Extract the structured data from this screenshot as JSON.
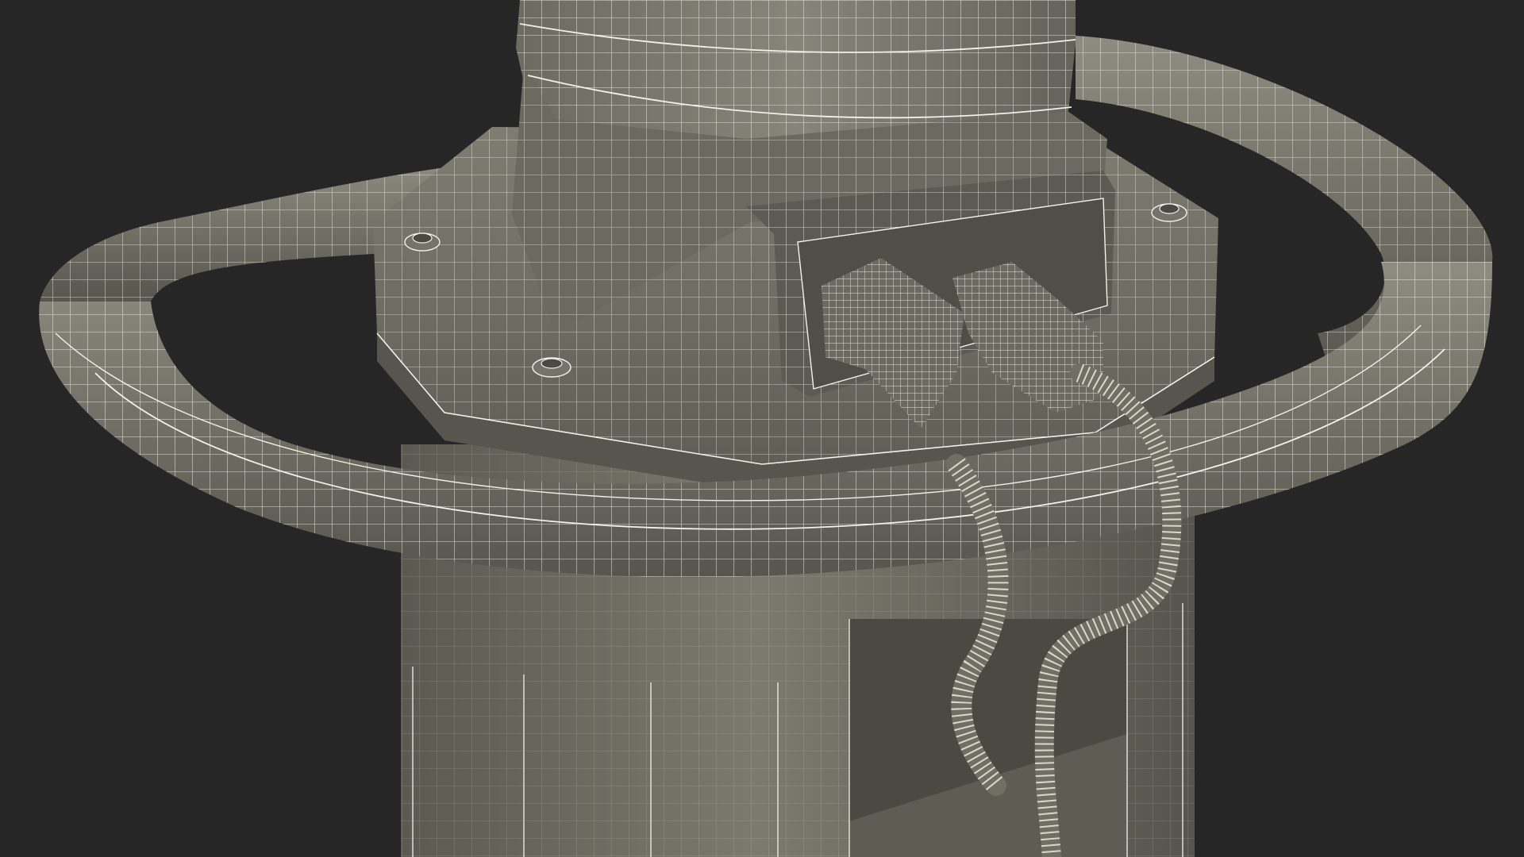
{
  "scene": {
    "subject": "wireframe-render",
    "colors": {
      "background": "#262626",
      "surface": "#6d6d62",
      "surface_light": "#8a8a7e",
      "surface_dark": "#4f4f47",
      "wire": "#f2f2ea",
      "shadow": "#3a3a34"
    },
    "icons": [
      "handle-ring",
      "column",
      "flange",
      "connector-housing",
      "cable",
      "bolt"
    ]
  }
}
